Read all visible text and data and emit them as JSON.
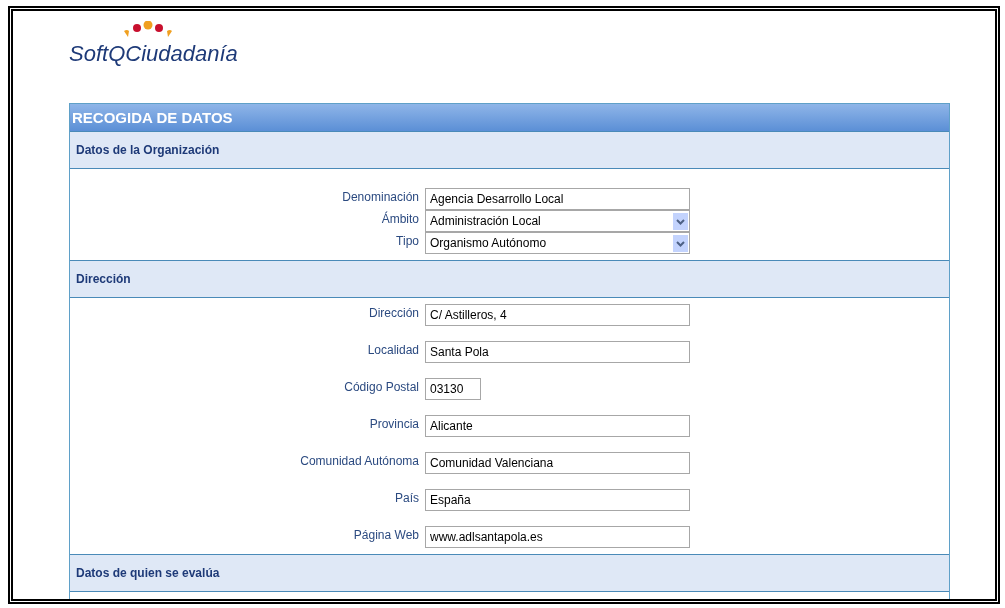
{
  "logo": {
    "text": "SoftQCiudadanía"
  },
  "panel": {
    "title": "RECOGIDA DE DATOS"
  },
  "sections": [
    {
      "title": "Datos de la Organización",
      "kind": "compact",
      "fields": [
        {
          "label": "Denominación",
          "kind": "text",
          "value": "Agencia Desarrollo Local"
        },
        {
          "label": "Ámbito",
          "kind": "select",
          "value": "Administración Local"
        },
        {
          "label": "Tipo",
          "kind": "select",
          "value": "Organismo Autónomo"
        }
      ]
    },
    {
      "title": "Dirección",
      "kind": "spaced",
      "fields": [
        {
          "label": "Dirección",
          "kind": "text",
          "value": "C/ Astilleros, 4"
        },
        {
          "label": "Localidad",
          "kind": "text",
          "value": "Santa Pola"
        },
        {
          "label": "Código Postal",
          "kind": "short",
          "value": "03130"
        },
        {
          "label": "Provincia",
          "kind": "text",
          "value": "Alicante"
        },
        {
          "label": "Comunidad Autónoma",
          "kind": "text",
          "value": "Comunidad Valenciana"
        },
        {
          "label": "País",
          "kind": "text",
          "value": "España"
        },
        {
          "label": "Página Web",
          "kind": "text",
          "value": "www.adlsantapola.es"
        }
      ]
    },
    {
      "title": "Datos de quien se evalúa",
      "kind": "spaced"
    }
  ]
}
